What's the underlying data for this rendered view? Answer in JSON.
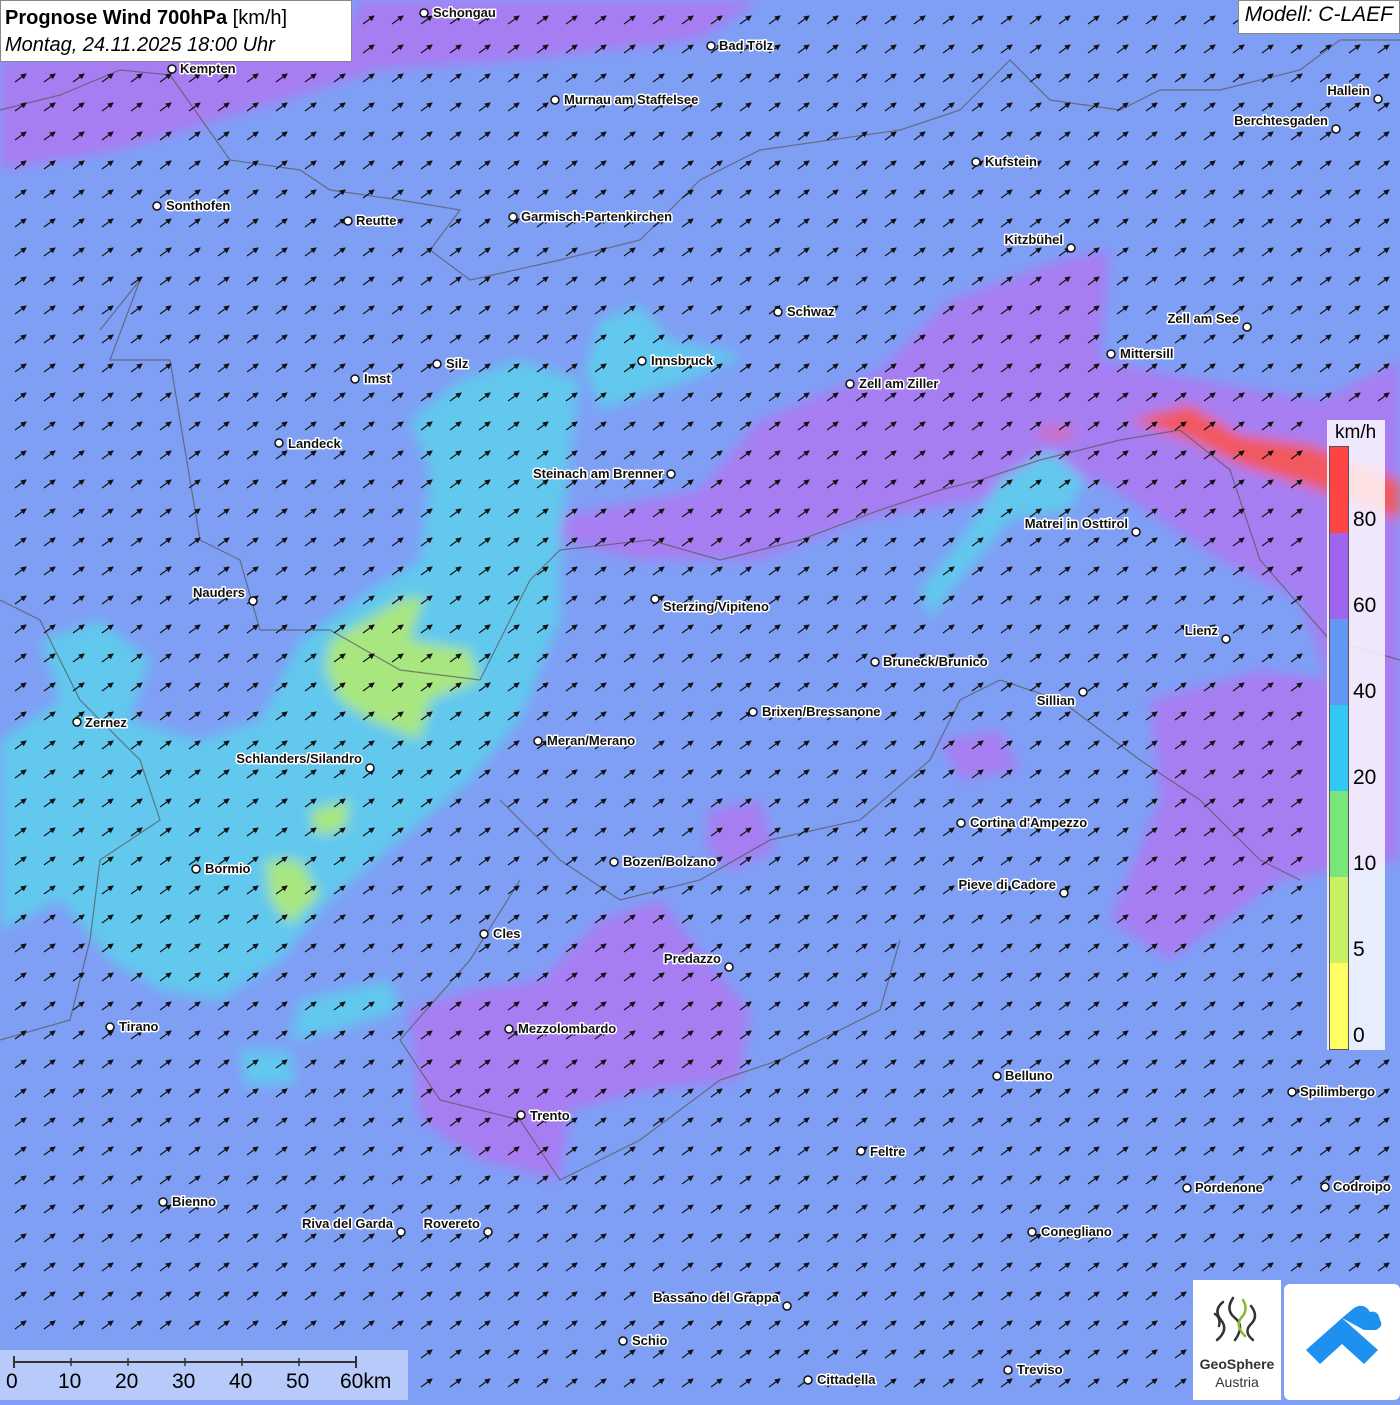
{
  "title": {
    "main": "Prognose Wind 700hPa",
    "unit": "[km/h]",
    "datetime": "Montag, 24.11.2025 18:00 Uhr"
  },
  "model": "Modell: C-LAEF",
  "legend": {
    "unit": "km/h",
    "labels": [
      "80",
      "60",
      "40",
      "20",
      "10",
      "5",
      "0"
    ],
    "colors": [
      "#ff4444",
      "#a064f0",
      "#6496f5",
      "#32c8f5",
      "#78e678",
      "#c8f064",
      "#ffff64"
    ]
  },
  "scalebar": {
    "labels": [
      "0",
      "10",
      "20",
      "30",
      "40",
      "50",
      "60km"
    ]
  },
  "logos": {
    "geosphere_line1": "GeoSphere",
    "geosphere_line2": "Austria"
  },
  "cities": [
    {
      "name": "Schongau"
    },
    {
      "name": "Kempten"
    },
    {
      "name": "Bad Tölz"
    },
    {
      "name": "Murnau am Staffelsee"
    },
    {
      "name": "Hallein"
    },
    {
      "name": "Berchtesgaden"
    },
    {
      "name": "Kufstein"
    },
    {
      "name": "Sonthofen"
    },
    {
      "name": "Reutte"
    },
    {
      "name": "Garmisch-Partenkirchen"
    },
    {
      "name": "Kitzbühel"
    },
    {
      "name": "Schwaz"
    },
    {
      "name": "Zell am See"
    },
    {
      "name": "Mittersill"
    },
    {
      "name": "Innsbruck"
    },
    {
      "name": "Imst"
    },
    {
      "name": "Silz"
    },
    {
      "name": "Zell am Ziller"
    },
    {
      "name": "Landeck"
    },
    {
      "name": "Steinach am Brenner"
    },
    {
      "name": "Matrei in Osttirol"
    },
    {
      "name": "Nauders"
    },
    {
      "name": "Sterzing/Vipiteno"
    },
    {
      "name": "Lienz"
    },
    {
      "name": "Bruneck/Brunico"
    },
    {
      "name": "Sillian"
    },
    {
      "name": "Zernez"
    },
    {
      "name": "Brixen/Bressanone"
    },
    {
      "name": "Meran/Merano"
    },
    {
      "name": "Schlanders/Silandro"
    },
    {
      "name": "Cortina d'Ampezzo"
    },
    {
      "name": "Bozen/Bolzano"
    },
    {
      "name": "Bormio"
    },
    {
      "name": "Pieve di Cadore"
    },
    {
      "name": "Cles"
    },
    {
      "name": "Predazzo"
    },
    {
      "name": "Tirano"
    },
    {
      "name": "Mezzolombardo"
    },
    {
      "name": "Belluno"
    },
    {
      "name": "Spilimbergo"
    },
    {
      "name": "Trento"
    },
    {
      "name": "Feltre"
    },
    {
      "name": "Pordenone"
    },
    {
      "name": "Codroipo"
    },
    {
      "name": "Bienno"
    },
    {
      "name": "Riva del Garda"
    },
    {
      "name": "Rovereto"
    },
    {
      "name": "Conegliano"
    },
    {
      "name": "Bassano del Grappa"
    },
    {
      "name": "Schio"
    },
    {
      "name": "Treviso"
    },
    {
      "name": "Cittadella"
    }
  ]
}
